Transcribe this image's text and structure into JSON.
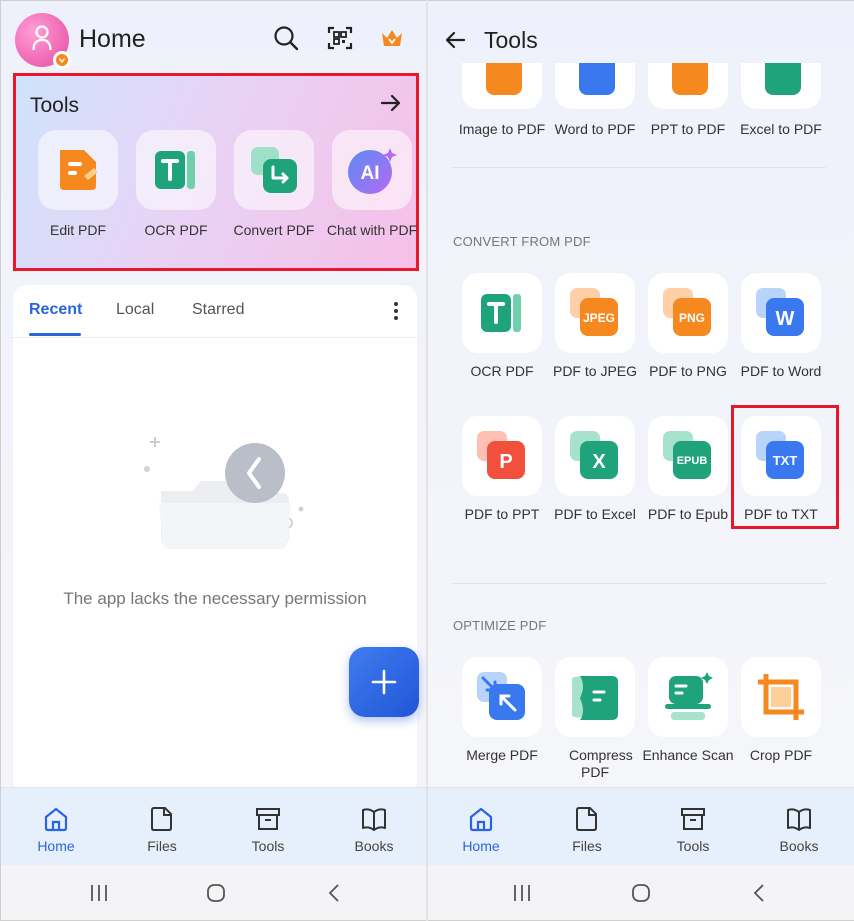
{
  "left": {
    "header": {
      "title": "Home"
    },
    "tools_card": {
      "title": "Tools",
      "items": [
        {
          "label": "Edit PDF",
          "icon": "edit-pdf-icon"
        },
        {
          "label": "OCR PDF",
          "icon": "ocr-pdf-icon"
        },
        {
          "label": "Convert PDF",
          "icon": "convert-pdf-icon"
        },
        {
          "label": "Chat with PDF",
          "icon": "chat-with-pdf-icon",
          "badge": "AI"
        }
      ]
    },
    "tabs": [
      "Recent",
      "Local",
      "Starred"
    ],
    "active_tab": "Recent",
    "empty_message": "The app lacks the necessary permission",
    "fab_label": "+"
  },
  "bottom_nav": {
    "items": [
      {
        "label": "Home",
        "icon": "home-icon",
        "active": true
      },
      {
        "label": "Files",
        "icon": "file-icon",
        "active": false
      },
      {
        "label": "Tools",
        "icon": "toolbox-icon",
        "active": false
      },
      {
        "label": "Books",
        "icon": "book-icon",
        "active": false
      }
    ]
  },
  "right": {
    "header": {
      "title": "Tools"
    },
    "top_row": [
      "Image to PDF",
      "Word to PDF",
      "PPT to PDF",
      "Excel to PDF"
    ],
    "convert_from_pdf": {
      "title": "CONVERT FROM PDF",
      "items": [
        {
          "label": "OCR PDF",
          "badge": "T"
        },
        {
          "label": "PDF to JPEG",
          "badge": "JPEG"
        },
        {
          "label": "PDF to PNG",
          "badge": "PNG"
        },
        {
          "label": "PDF to Word",
          "badge": "W"
        },
        {
          "label": "PDF to PPT",
          "badge": "P"
        },
        {
          "label": "PDF to Excel",
          "badge": "X"
        },
        {
          "label": "PDF to Epub",
          "badge": "EPUB"
        },
        {
          "label": "PDF to TXT",
          "badge": "TXT"
        }
      ]
    },
    "optimize_pdf": {
      "title": "OPTIMIZE PDF",
      "items": [
        {
          "label": "Merge PDF"
        },
        {
          "label": "Compress PDF"
        },
        {
          "label": "Enhance Scan"
        },
        {
          "label": "Crop PDF"
        }
      ]
    }
  },
  "colors": {
    "accent": "#2a64e0",
    "highlight": "#e8182a",
    "orange": "#f5891f",
    "green": "#1fa37a",
    "blue": "#3a78f0",
    "red": "#f0503c",
    "nav_bg": "#e6effc"
  }
}
